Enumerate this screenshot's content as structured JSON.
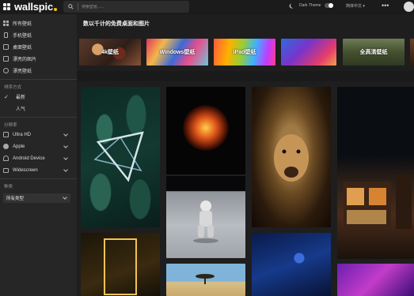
{
  "header": {
    "logo_text": "wallspic",
    "search_placeholder": "搜索壁纸......",
    "theme_label": "Dark Theme",
    "language": "简体中文 ▾",
    "more": "•••"
  },
  "sidebar": {
    "nav": [
      {
        "label": "所有壁纸",
        "icon": "grid-icon"
      },
      {
        "label": "手机壁纸",
        "icon": "phone-icon"
      },
      {
        "label": "桌面壁纸",
        "icon": "monitor-icon"
      },
      {
        "label": "漂亮的图片",
        "icon": "image-icon"
      },
      {
        "label": "漂亮壁纸",
        "icon": "badge-icon"
      }
    ],
    "sort_heading": "排序方式",
    "sort": [
      {
        "label": "最新",
        "selected": true
      },
      {
        "label": "人气",
        "selected": false
      }
    ],
    "resolution_heading": "分辨率",
    "resolutions": [
      {
        "label": "Ultra HD",
        "icon": "hd-icon"
      },
      {
        "label": "Apple",
        "icon": "apple-icon"
      },
      {
        "label": "Android Device",
        "icon": "android-icon"
      },
      {
        "label": "Widescreen",
        "icon": "widescreen-icon"
      }
    ],
    "type_heading": "种类",
    "type_value": "所有类型"
  },
  "main": {
    "title": "数以千计的免费桌面和图片",
    "categories": [
      {
        "label": "4k壁纸"
      },
      {
        "label": "Windows壁纸"
      },
      {
        "label": "iPad壁纸"
      },
      {
        "label": ""
      },
      {
        "label": "全高清壁纸"
      },
      {
        "label": ""
      }
    ]
  },
  "colors": {
    "accent_dot": "#f5c400",
    "background": "#1e1e1e",
    "sidebar": "#262626"
  }
}
